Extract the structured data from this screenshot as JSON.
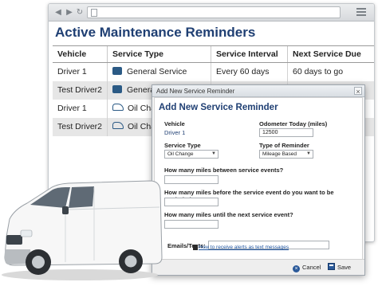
{
  "browser": {
    "back_icon": "back-arrow-icon",
    "forward_icon": "forward-arrow-icon",
    "refresh_icon": "refresh-icon",
    "menu_icon": "menu-icon"
  },
  "page": {
    "title": "Active Maintenance Reminders"
  },
  "table": {
    "headers": [
      "Vehicle",
      "Service Type",
      "Service Interval",
      "Next Service Due"
    ],
    "rows": [
      {
        "vehicle": "Driver 1",
        "service_type": "General Service",
        "service_icon": "mechanic-icon",
        "interval": "Every 60 days",
        "next_due": "60 days to go"
      },
      {
        "vehicle": "Test Driver2",
        "service_type": "General Service",
        "service_icon": "mechanic-icon",
        "interval": "",
        "next_due": ""
      },
      {
        "vehicle": "Driver 1",
        "service_type": "Oil Cha",
        "service_icon": "oil-can-icon",
        "interval": "",
        "next_due": ""
      },
      {
        "vehicle": "Test Driver2",
        "service_type": "Oil Cha",
        "service_icon": "oil-can-icon",
        "interval": "",
        "next_due": ""
      }
    ]
  },
  "dialog": {
    "window_title": "Add New Service Reminder",
    "heading": "Add New Service Reminder",
    "vehicle_label": "Vehicle",
    "vehicle_value": "Driver 1",
    "odometer_label": "Odometer Today (miles)",
    "odometer_value": "12500",
    "service_type_label": "Service Type",
    "service_type_value": "Oil Change",
    "reminder_type_label": "Type of Reminder",
    "reminder_type_value": "Mileage Based",
    "q_between": "How many miles between service events?",
    "q_before": "How many miles before the service event do you want to be reminded?",
    "q_until": "How many miles until the next service event?",
    "emails_label": "Emails/Texts:",
    "help_link": "How to receive alerts as text messages",
    "cancel_label": "Cancel",
    "save_label": "Save"
  },
  "colors": {
    "accent": "#1f3f73",
    "row_alt": "#e6e6e6"
  }
}
